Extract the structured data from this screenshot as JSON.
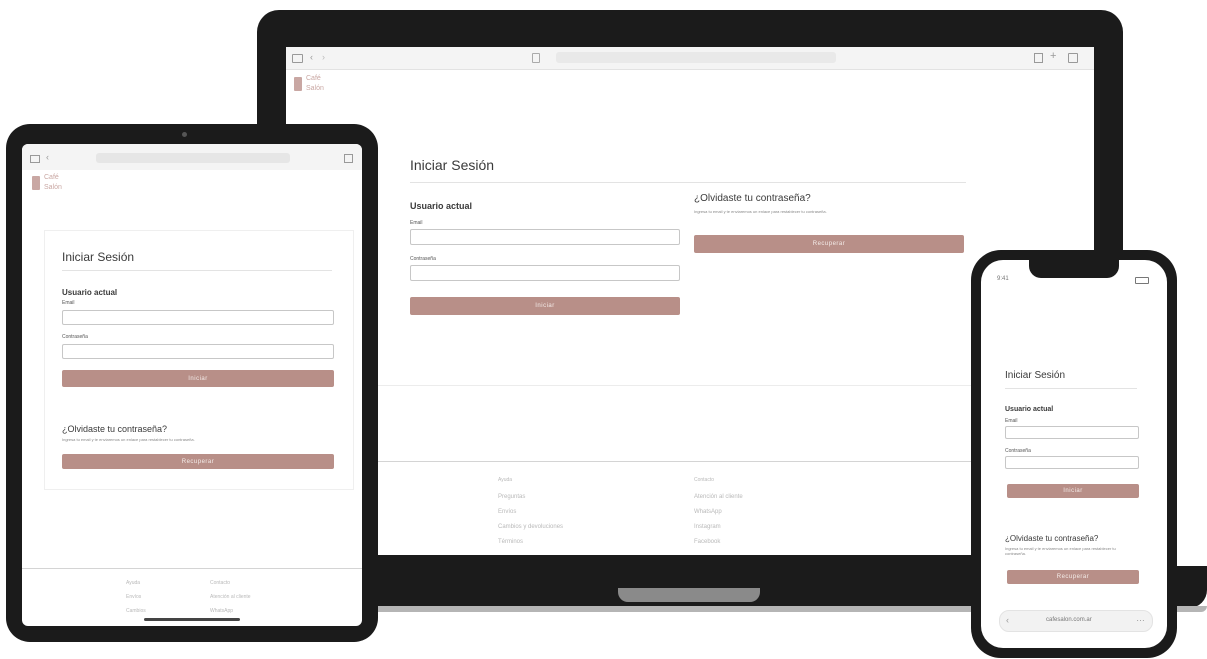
{
  "login": {
    "title": "Iniciar Sesión",
    "section_user": "Usuario actual",
    "field_email_label": "Email",
    "field_password_label": "Contraseña",
    "submit_label": "Iniciar",
    "forgot_title": "¿Olvidaste tu contraseña?",
    "forgot_text": "Ingresa tu email y te enviaremos un enlace para restablecer tu contraseña.",
    "forgot_button": "Recuperar"
  },
  "brand": {
    "line1": "Café",
    "line2": "Salón"
  },
  "laptop_footer": {
    "col1_title": "Ayuda",
    "col1": [
      "Preguntas",
      "Envíos",
      "Cambios y devoluciones",
      "Términos"
    ],
    "col2_title": "Contacto",
    "col2": [
      "Atención al cliente",
      "WhatsApp",
      "Instagram",
      "Facebook"
    ]
  },
  "tablet_footer": {
    "col1": [
      "Ayuda",
      "Envíos",
      "Cambios"
    ],
    "col2": [
      "Contacto",
      "Atención al cliente",
      "WhatsApp"
    ]
  },
  "phone": {
    "status_time": "9:41",
    "url": "cafesalon.com.ar"
  },
  "colors": {
    "accent": "#b88f88",
    "device_frame": "#1b1b1b"
  }
}
